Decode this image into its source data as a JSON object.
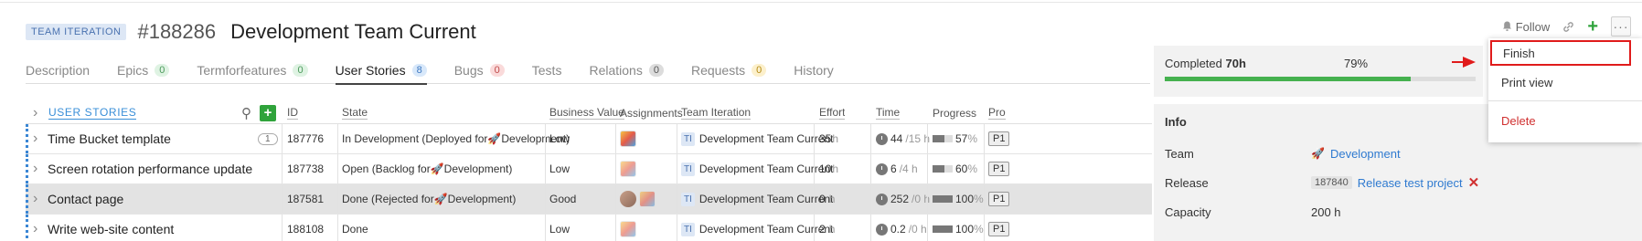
{
  "header": {
    "type_badge": "TEAM ITERATION",
    "id": "#188286",
    "title": "Development Team Current",
    "follow_label": "Follow"
  },
  "tabs": [
    {
      "label": "Description",
      "count": null
    },
    {
      "label": "Epics",
      "count": "0"
    },
    {
      "label": "Termforfeatures",
      "count": "0"
    },
    {
      "label": "User Stories",
      "count": "8"
    },
    {
      "label": "Bugs",
      "count": "0"
    },
    {
      "label": "Tests",
      "count": null
    },
    {
      "label": "Relations",
      "count": "0"
    },
    {
      "label": "Requests",
      "count": "0"
    },
    {
      "label": "History",
      "count": null
    }
  ],
  "grid": {
    "section_label": "USER STORIES",
    "columns": {
      "id": "ID",
      "state": "State",
      "business_value": "Business Value",
      "assignments": "Assignments",
      "team_iteration": "Team Iteration",
      "effort": "Effort",
      "time": "Time",
      "progress": "Progress",
      "priority": "Pro"
    },
    "rows": [
      {
        "name": "Time Bucket template",
        "count": "1",
        "id": "187776",
        "state_pre": "In Development (Deployed for ",
        "state_post": " Development)",
        "bv": "Low",
        "ti_badge": "TI",
        "ti": "Development Team Current",
        "effort": "35",
        "effort_unit": "h",
        "time_spent": "44",
        "time_rest": "/15 h",
        "progress": "57",
        "pct_unit": "%",
        "prio": "P1"
      },
      {
        "name": "Screen rotation performance update",
        "count": "",
        "id": "187738",
        "state_pre": "Open (Backlog for ",
        "state_post": " Development)",
        "bv": "Low",
        "ti_badge": "TI",
        "ti": "Development Team Current",
        "effort": "10",
        "effort_unit": "h",
        "time_spent": "6",
        "time_rest": "/4 h",
        "progress": "60",
        "pct_unit": "%",
        "prio": "P1"
      },
      {
        "name": "Contact page",
        "count": "",
        "id": "187581",
        "state_pre": "Done (Rejected for ",
        "state_post": " Development)",
        "bv": "Good",
        "ti_badge": "TI",
        "ti": "Development Team Current",
        "effort": "0",
        "effort_unit": "h",
        "time_spent": "252",
        "time_rest": "/0 h",
        "progress": "100",
        "pct_unit": "%",
        "prio": "P1"
      },
      {
        "name": "Write web-site content",
        "count": "",
        "id": "188108",
        "state_pre": "Done",
        "state_post": "",
        "bv": "Low",
        "ti_badge": "TI",
        "ti": "Development Team Current",
        "effort": "2",
        "effort_unit": "h",
        "time_spent": "0.2",
        "time_rest": "/0 h",
        "progress": "100",
        "pct_unit": "%",
        "prio": "P1"
      }
    ]
  },
  "completed": {
    "label": "Completed",
    "hours": "70h",
    "percent_text": "79%",
    "fraction": 0.79
  },
  "info": {
    "title": "Info",
    "team_label": "Team",
    "team_value": "Development",
    "release_label": "Release",
    "release_id": "187840",
    "release_value": "Release test project",
    "capacity_label": "Capacity",
    "capacity_value": "200 h"
  },
  "menu": {
    "finish": "Finish",
    "print_view": "Print view",
    "delete": "Delete"
  },
  "colors": {
    "accent_blue": "#2f7ad0",
    "add_green": "#2fa33b",
    "highlight_red": "#e01b1b"
  }
}
